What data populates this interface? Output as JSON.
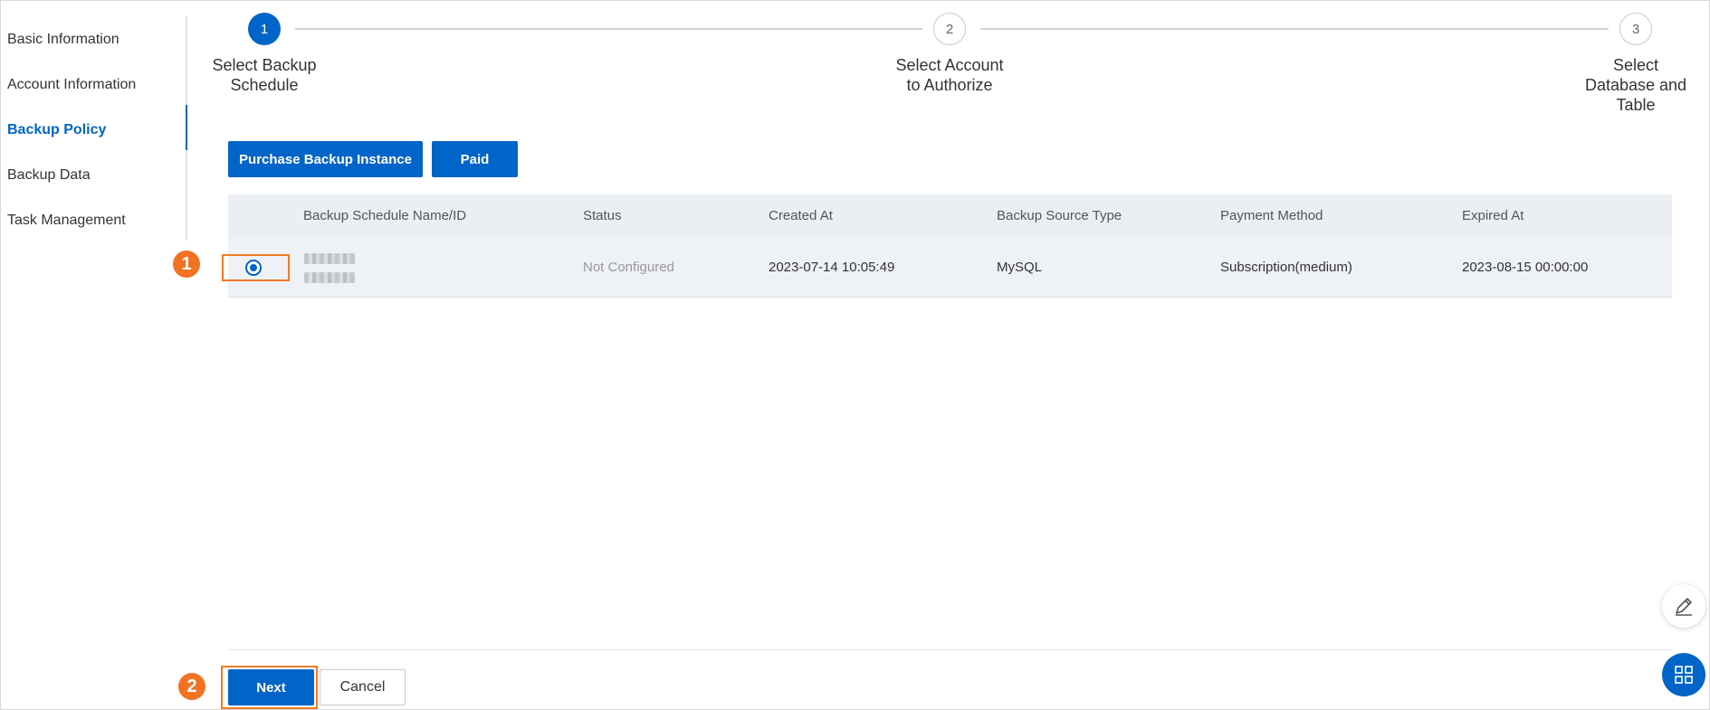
{
  "sidebar": {
    "items": [
      {
        "label": "Basic Information"
      },
      {
        "label": "Account Information"
      },
      {
        "label": "Backup Policy",
        "active": true
      },
      {
        "label": "Backup Data"
      },
      {
        "label": "Task Management"
      }
    ]
  },
  "steps": [
    {
      "number": "1",
      "label_line1": "Select Backup",
      "label_line2": "Schedule",
      "label_line3": "",
      "state": "active"
    },
    {
      "number": "2",
      "label_line1": "Select Account",
      "label_line2": "to Authorize",
      "label_line3": "",
      "state": "idle"
    },
    {
      "number": "3",
      "label_line1": "Select",
      "label_line2": "Database and",
      "label_line3": "Table",
      "state": "idle"
    }
  ],
  "toolbar": {
    "purchase_label": "Purchase Backup Instance",
    "paid_label": "Paid"
  },
  "table": {
    "columns": [
      "Backup Schedule Name/ID",
      "Status",
      "Created At",
      "Backup Source Type",
      "Payment Method",
      "Expired At"
    ],
    "rows": [
      {
        "selected": true,
        "name_redacted": true,
        "status": "Not Configured",
        "created_at": "2023-07-14 10:05:49",
        "source_type": "MySQL",
        "payment_method": "Subscription(medium)",
        "expired_at": "2023-08-15 00:00:00"
      }
    ]
  },
  "footer": {
    "next_label": "Next",
    "cancel_label": "Cancel"
  },
  "annotations": {
    "badge1": "1",
    "badge2": "2"
  },
  "floating": {
    "edit_icon": "pencil-icon",
    "apps_icon": "grid-icon"
  },
  "colors": {
    "primary": "#0064c8",
    "annotation": "#f27222"
  }
}
